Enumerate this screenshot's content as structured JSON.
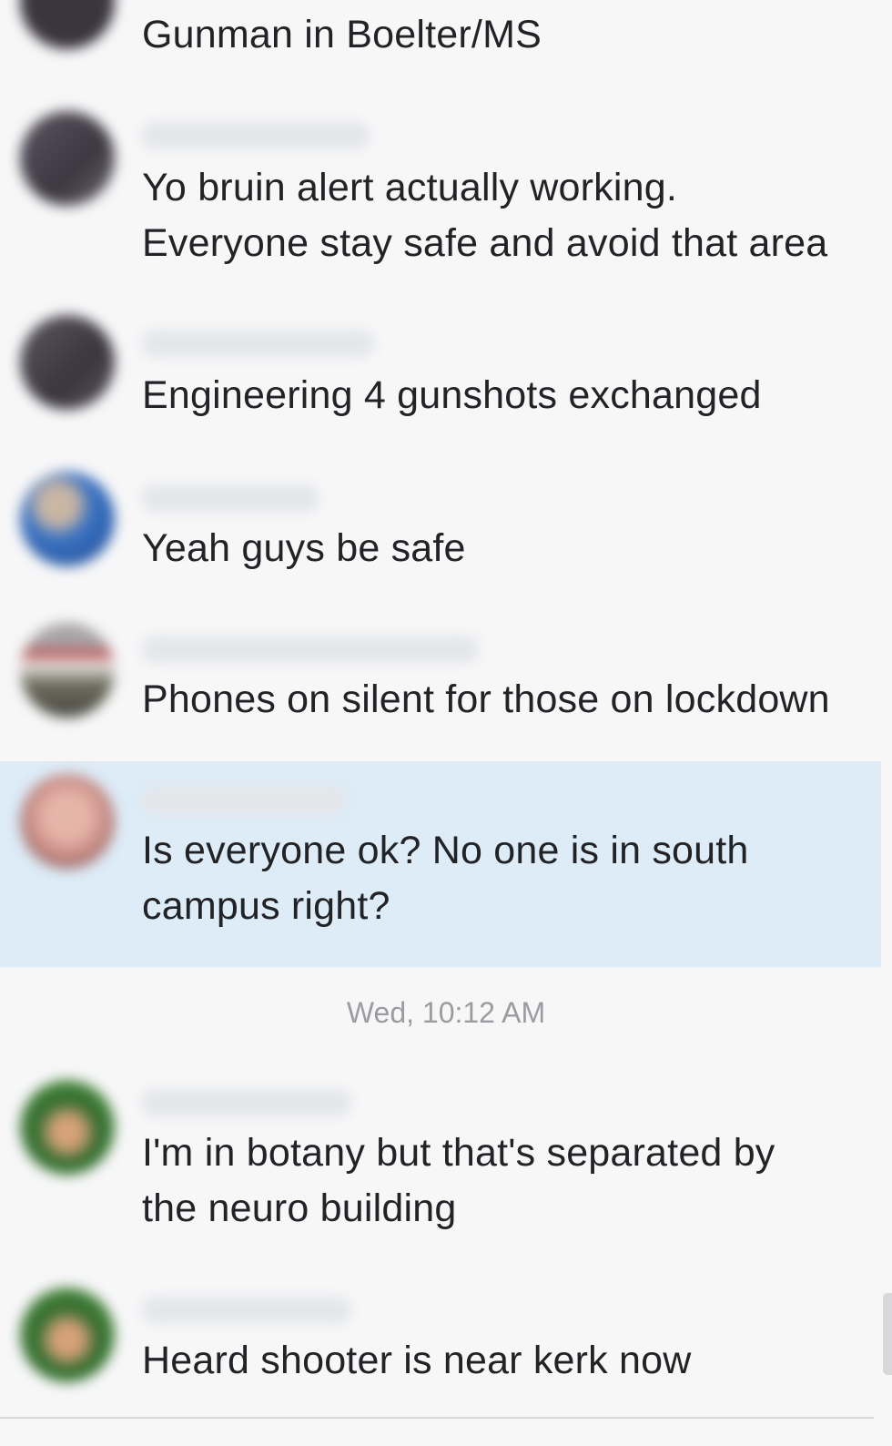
{
  "messages": [
    {
      "text": "Gunman in Boelter/MS",
      "avatar_color": "#3a3640"
    },
    {
      "text": "Yo bruin alert actually working.\nEveryone stay safe and avoid that area",
      "avatar_color": "#4a4650"
    },
    {
      "text": "Engineering 4 gunshots exchanged",
      "avatar_color": "#46424c"
    },
    {
      "text": "Yeah guys be safe",
      "avatar_color": "#3a73c4"
    },
    {
      "text": "Phones on silent for those on lockdown",
      "avatar_color": "#8a6262"
    },
    {
      "text": "Is everyone ok? No one is in south\ncampus right?",
      "avatar_color": "#d59b95"
    },
    {
      "text": "I'm in botany but that's separated by\nthe neuro building",
      "avatar_color": "#2f6a2e"
    },
    {
      "text": "Heard shooter is near kerk now",
      "avatar_color": "#2f6a2e"
    }
  ],
  "timestamp": "Wed, 10:12 AM",
  "colors": {
    "background": "#f7f7f8",
    "highlight": "#ddecf7",
    "text": "#222326",
    "timestamp": "#9a9ca1"
  }
}
